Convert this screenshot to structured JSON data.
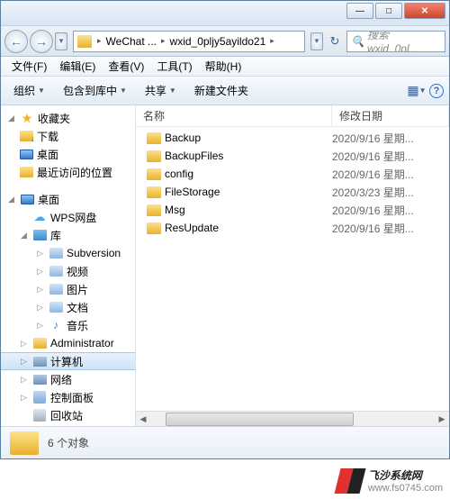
{
  "titlebar": {
    "min": "—",
    "max": "□",
    "close": "✕"
  },
  "nav": {
    "back": "←",
    "fwd": "→",
    "crumb1": "WeChat ...",
    "crumb2": "wxid_0pljy5ayildo21",
    "search_placeholder": "搜索 wxid_0pl...",
    "refresh": "↻"
  },
  "menu": {
    "file": "文件(F)",
    "edit": "编辑(E)",
    "view": "查看(V)",
    "tools": "工具(T)",
    "help": "帮助(H)"
  },
  "toolbar": {
    "organize": "组织",
    "include": "包含到库中",
    "share": "共享",
    "newfolder": "新建文件夹"
  },
  "sidebar": {
    "favorites": "收藏夹",
    "downloads": "下载",
    "desktop": "桌面",
    "recent": "最近访问的位置",
    "desktop2": "桌面",
    "wps": "WPS网盘",
    "library": "库",
    "subversion": "Subversion",
    "video": "视频",
    "pictures": "图片",
    "documents": "文档",
    "music": "音乐",
    "admin": "Administrator",
    "computer": "计算机",
    "network": "网络",
    "control": "控制面板",
    "recycle": "回收站"
  },
  "columns": {
    "name": "名称",
    "date": "修改日期"
  },
  "files": [
    {
      "name": "Backup",
      "date": "2020/9/16 星期..."
    },
    {
      "name": "BackupFiles",
      "date": "2020/9/16 星期..."
    },
    {
      "name": "config",
      "date": "2020/9/16 星期..."
    },
    {
      "name": "FileStorage",
      "date": "2020/3/23 星期..."
    },
    {
      "name": "Msg",
      "date": "2020/9/16 星期..."
    },
    {
      "name": "ResUpdate",
      "date": "2020/9/16 星期..."
    }
  ],
  "status": {
    "count": "6 个对象"
  },
  "watermark": {
    "brand": "飞沙系统网",
    "url": "www.fs0745.com"
  }
}
